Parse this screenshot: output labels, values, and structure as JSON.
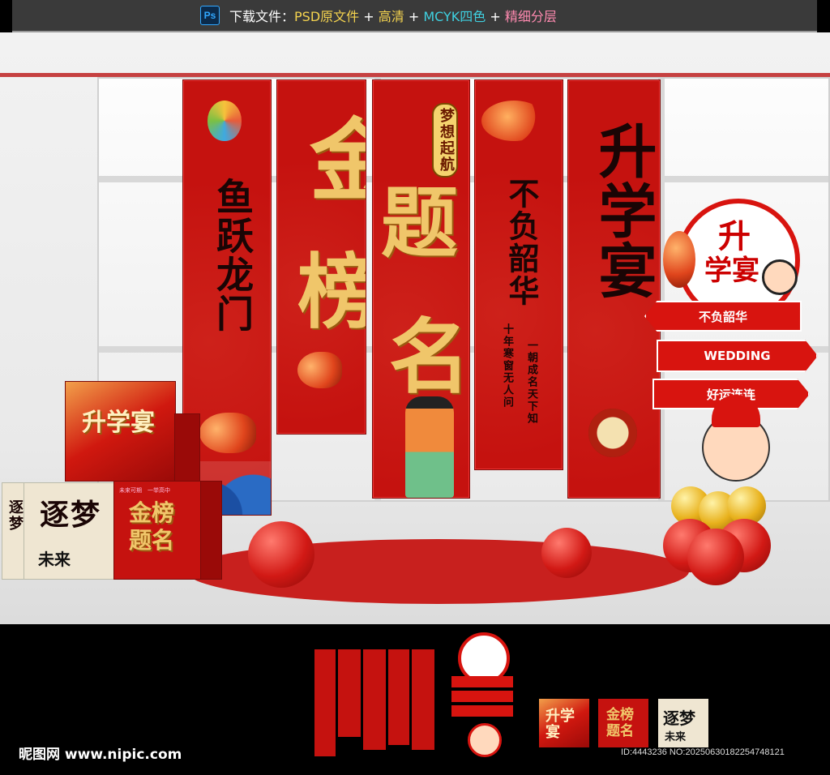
{
  "topbar": {
    "icon": "photoshop-icon",
    "icon_label": "Ps",
    "prefix": "下载文件：",
    "psd": "PSD原文件",
    "plus1": " + ",
    "hd": "高清",
    "plus2": " + ",
    "cmyk": "MCYK四色",
    "plus3": " + ",
    "layers": "精细分层"
  },
  "banners": {
    "b1": "鱼跃龙门",
    "b2_a": "金",
    "b2_b": "榜",
    "b3_badge": "梦想起航",
    "b3_a": "题",
    "b3_b": "名",
    "b4_main": "不负韶华",
    "b4_poem1": "十年寒窗无人问",
    "b4_poem2": "一朝成名天下知",
    "b5": "升学宴"
  },
  "signboard": {
    "title_top": "升",
    "title_bottom": "学宴",
    "arrow1": "不负韶华",
    "arrow2": "WEDDING",
    "arrow3": "好运连连"
  },
  "boxes": {
    "box1": "升学宴",
    "box2_main": "逐梦",
    "box2_sub": "未来",
    "box3_small": "未来可期　一举高中",
    "box3_main": "金榜题名",
    "box4_side": "逐梦"
  },
  "thumbs": {
    "t1": "升学宴",
    "t2": "金榜题名",
    "t3_main": "逐梦",
    "t3_sub": "未来"
  },
  "footer": {
    "site": "昵图网 www.nipic.com",
    "id": "ID:4443236 NO:20250630182254748121"
  },
  "colors": {
    "red": "#c5120f",
    "gold": "#f0c66a",
    "bar": "#3a3a3a"
  }
}
